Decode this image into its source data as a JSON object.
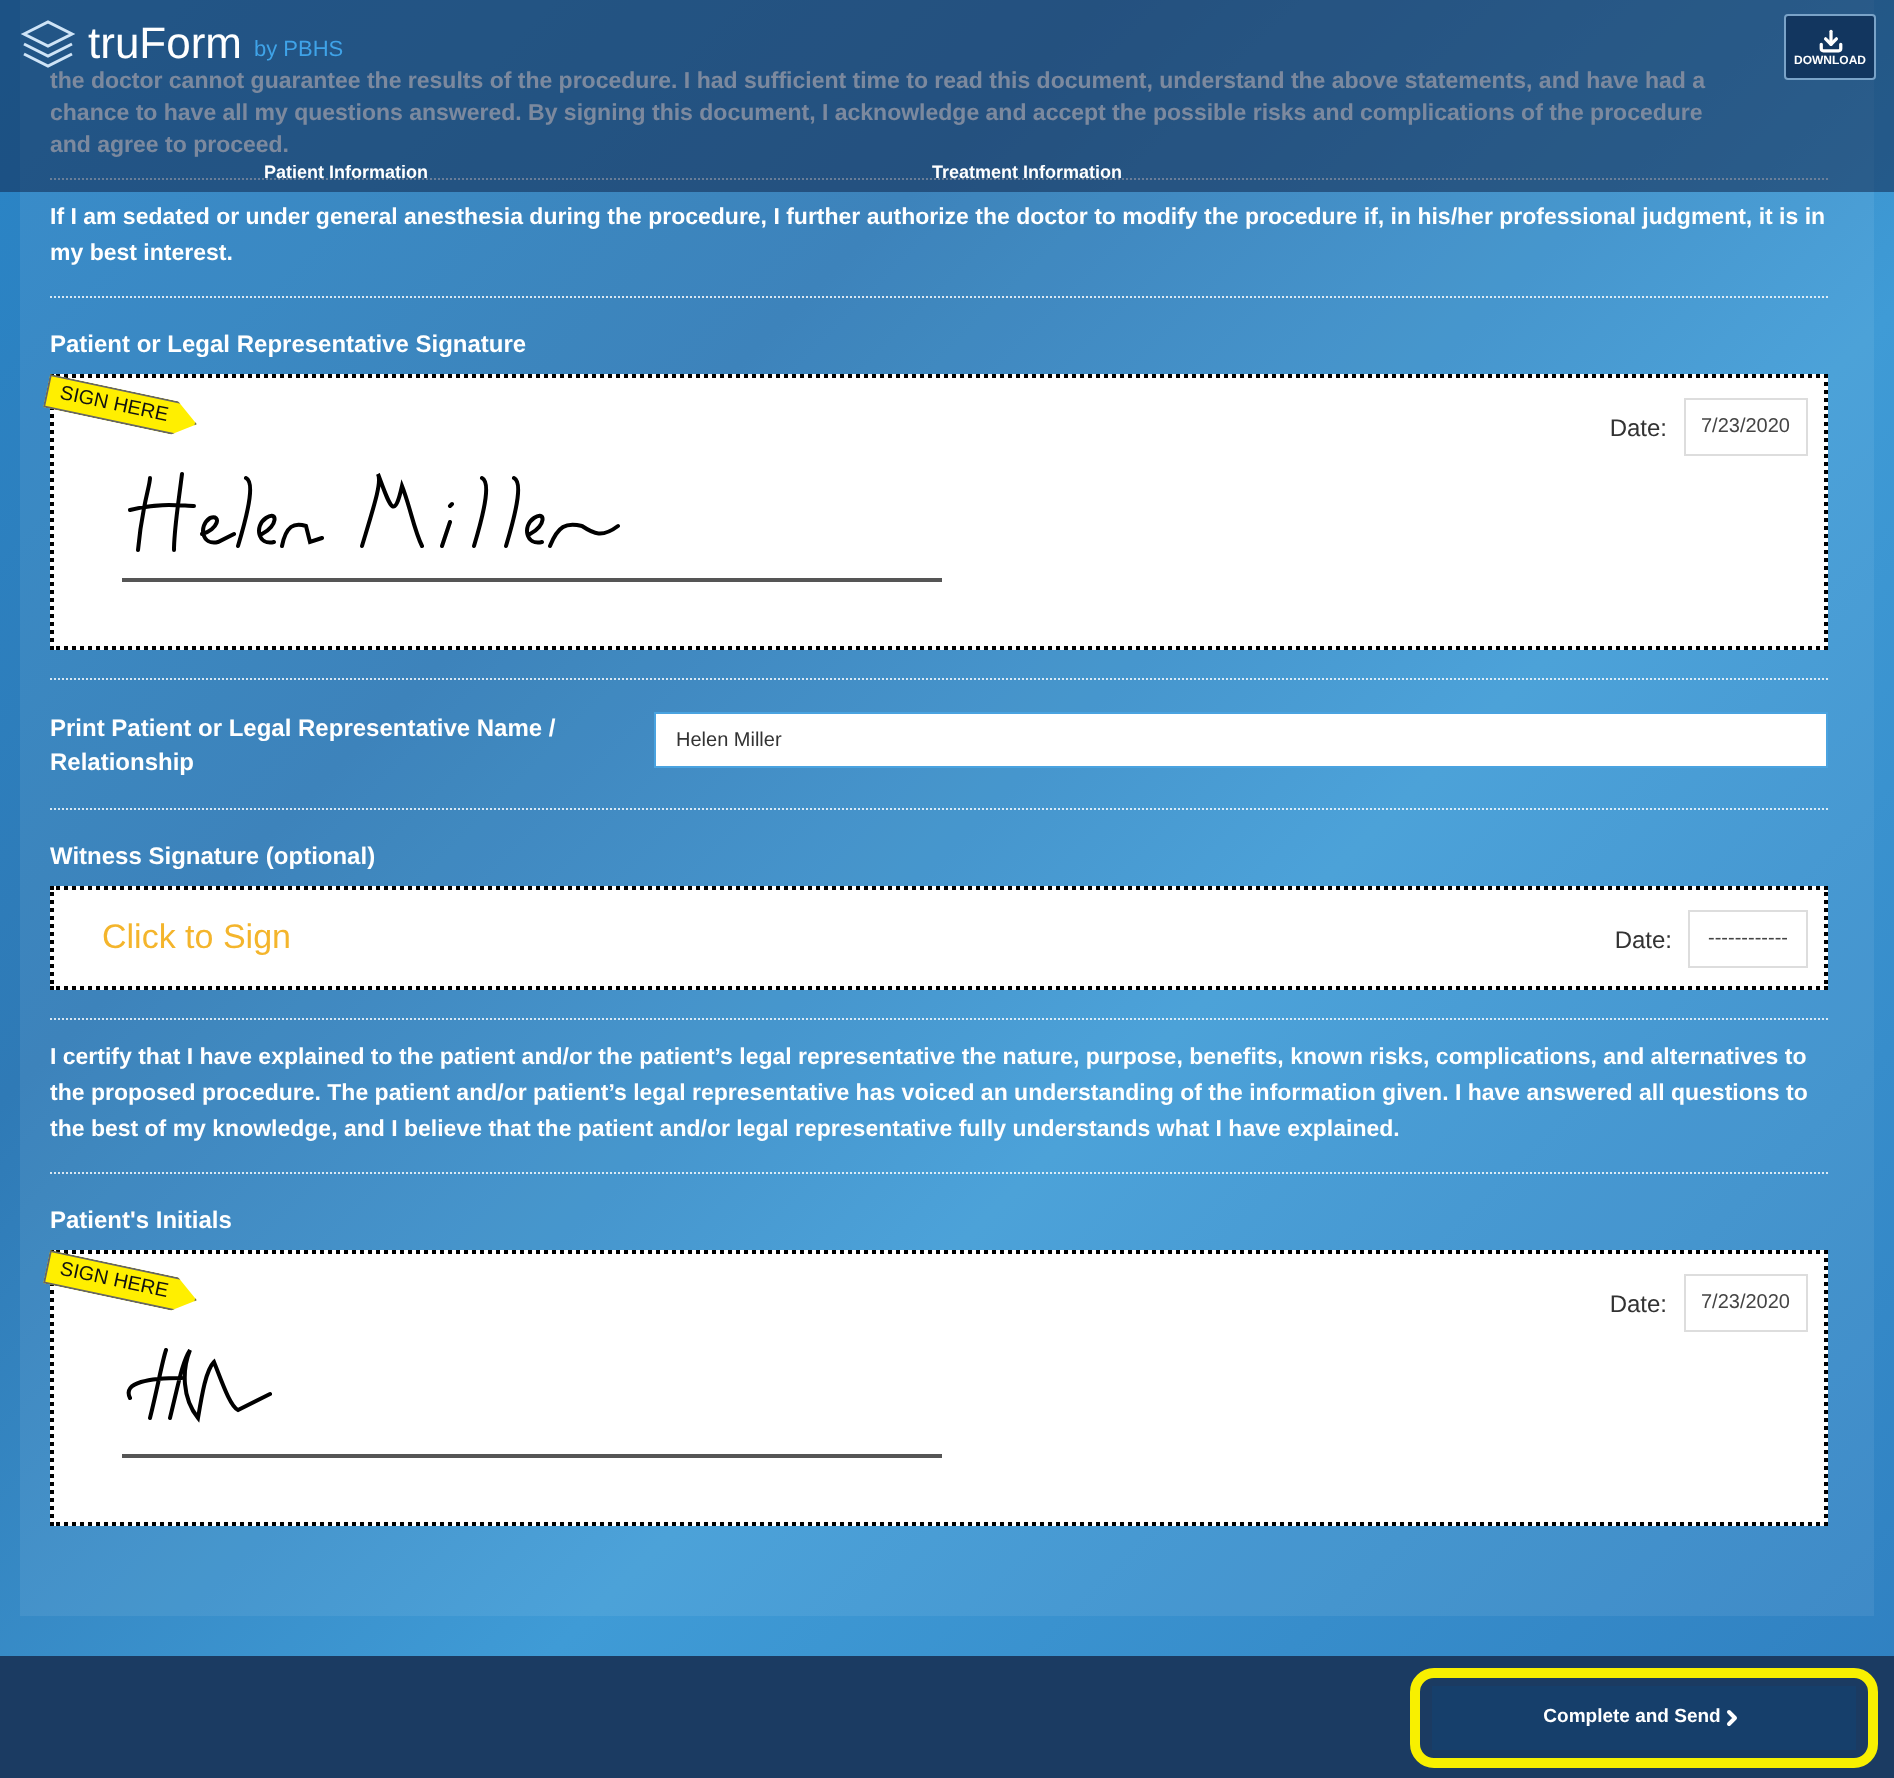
{
  "header": {
    "logo": "truForm",
    "byline": "by PBHS",
    "download": "DOWNLOAD",
    "tabs": [
      {
        "label": "Patient Information"
      },
      {
        "label": "Treatment Information"
      }
    ]
  },
  "sections": [
    {
      "kind": "paragraph",
      "text": "the doctor cannot guarantee the results of the procedure. I had sufficient time to read this document, understand the above statements, and have had a chance to have all my questions answered. By signing this document, I acknowledge and accept the possible risks and complications of the procedure and agree to proceed."
    },
    {
      "kind": "paragraph",
      "text": "If I am sedated or under general anesthesia during the procedure, I further authorize the doctor to modify the procedure if, in his/her professional judgment, it is in my best interest."
    },
    {
      "kind": "signature",
      "label": "Patient or Legal Representative Signature",
      "signed": true,
      "signature": {
        "kind": "name"
      },
      "tag": "SIGN HERE",
      "date_label": "Date:",
      "date": "7/23/2020"
    },
    {
      "kind": "text_field",
      "label": "Print Patient or Legal Representative Name / Relationship",
      "value": "Helen Miller"
    },
    {
      "kind": "signature",
      "label": "Witness Signature (optional)",
      "signed": false,
      "prompt": "Click to Sign",
      "date_label": "Date:",
      "date": "------------"
    },
    {
      "kind": "paragraph",
      "text": "I certify that I have explained to the patient and/or the patient’s legal representative the nature, purpose, benefits, known risks, complications, and alternatives to the proposed procedure. The patient and/or patient’s legal representative has voiced an understanding of the information given. I have answered all questions to the best of my knowledge, and I believe that the patient and/or legal representative fully understands what I have explained."
    },
    {
      "kind": "signature",
      "label": "Patient's Initials",
      "signed": true,
      "signature": {
        "kind": "initials"
      },
      "tag": "SIGN HERE",
      "date_label": "Date:",
      "date": "7/23/2020"
    }
  ],
  "footer": {
    "submit": "Complete and Send",
    "highlighted": true
  }
}
